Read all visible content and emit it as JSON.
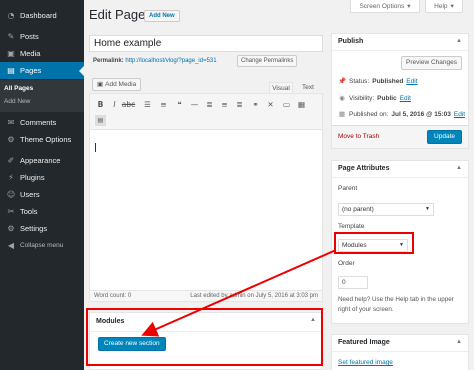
{
  "sidebar": {
    "items": [
      {
        "label": "Dashboard",
        "icon": "dashboard-icon",
        "glyph": "◔"
      },
      {
        "label": "Posts",
        "icon": "pin-icon",
        "glyph": "✎"
      },
      {
        "label": "Media",
        "icon": "media-icon",
        "glyph": "▣"
      },
      {
        "label": "Pages",
        "icon": "pages-icon",
        "glyph": "▤"
      },
      {
        "label": "Comments",
        "icon": "comments-icon",
        "glyph": "✉"
      },
      {
        "label": "Theme Options",
        "icon": "theme-options-icon",
        "glyph": "⚙"
      },
      {
        "label": "Appearance",
        "icon": "appearance-icon",
        "glyph": "✐"
      },
      {
        "label": "Plugins",
        "icon": "plugins-icon",
        "glyph": "⚡"
      },
      {
        "label": "Users",
        "icon": "users-icon",
        "glyph": "☺"
      },
      {
        "label": "Tools",
        "icon": "tools-icon",
        "glyph": "✂"
      },
      {
        "label": "Settings",
        "icon": "settings-icon",
        "glyph": "⚙"
      },
      {
        "label": "Collapse menu",
        "icon": "collapse-icon",
        "glyph": "◀"
      }
    ],
    "submenu": [
      "All Pages",
      "Add New"
    ]
  },
  "header": {
    "title": "Edit Page",
    "add_new": "Add New",
    "screen_options": "Screen Options",
    "help": "Help"
  },
  "editor": {
    "post_title": "Home example",
    "permalink_label": "Permalink:",
    "permalink_url": "http://localhost/vlog/?page_id=531",
    "change_permalinks": "Change Permalinks",
    "add_media": "Add Media",
    "tab_visual": "Visual",
    "tab_text": "Text",
    "word_count": "Word count: 0",
    "last_edited": "Last edited by admin on July 5, 2016 at 3:03 pm"
  },
  "modules": {
    "title": "Modules",
    "create_button": "Create new section"
  },
  "publish": {
    "title": "Publish",
    "preview": "Preview Changes",
    "status_label": "Status:",
    "status_value": "Published",
    "visibility_label": "Visibility:",
    "visibility_value": "Public",
    "published_label": "Published on:",
    "published_value": "Jul 5, 2016 @ 15:03",
    "edit": "Edit",
    "move_trash": "Move to Trash",
    "update": "Update"
  },
  "page_attributes": {
    "title": "Page Attributes",
    "parent_label": "Parent",
    "parent_value": "(no parent)",
    "template_label": "Template",
    "template_value": "Modules",
    "order_label": "Order",
    "order_value": "0",
    "help_text": "Need help? Use the Help tab in the upper right of your screen."
  },
  "featured_image": {
    "title": "Featured Image",
    "set_link": "Set featured image"
  },
  "colors": {
    "sidebar_bg": "#23282d",
    "accent": "#0073aa",
    "primary_button": "#0085ba",
    "annotation": "#ee0000"
  }
}
